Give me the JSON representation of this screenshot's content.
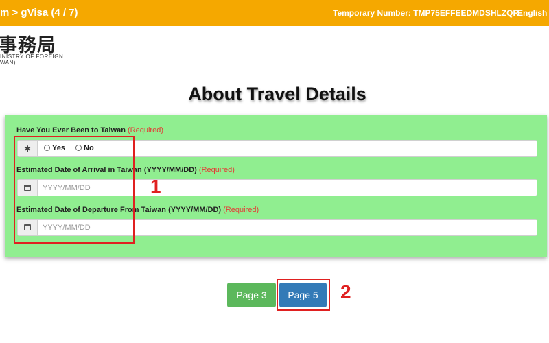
{
  "header": {
    "breadcrumb": "m > gVisa (4 / 7)",
    "temporary_number": "Temporary Number: TMP75EFFEEDMDSHLZQR",
    "language": "English"
  },
  "logo": {
    "chinese_text": "事務局",
    "english_line1": "INISTRY OF FOREIGN",
    "english_line2": "WAN)"
  },
  "page_title": "About Travel Details",
  "form": {
    "visited_taiwan": {
      "label": "Have You Ever Been to Taiwan",
      "required": "(Required)",
      "options": [
        "Yes",
        "No"
      ]
    },
    "arrival_date": {
      "label": "Estimated Date of Arrival in Taiwan (YYYY/MM/DD)",
      "required": "(Required)",
      "placeholder": "YYYY/MM/DD"
    },
    "departure_date": {
      "label": "Estimated Date of Departure From Taiwan (YYYY/MM/DD)",
      "required": "(Required)",
      "placeholder": "YYYY/MM/DD"
    }
  },
  "buttons": {
    "previous": "Page 3",
    "next": "Page 5"
  },
  "annotations": {
    "step1": "1",
    "step2": "2"
  },
  "colors": {
    "topbar": "#f5a800",
    "panel": "#90ee90",
    "required": "#e53935",
    "previous_button": "#5cb85c",
    "next_button": "#337ab7",
    "annotation": "#e02020"
  }
}
